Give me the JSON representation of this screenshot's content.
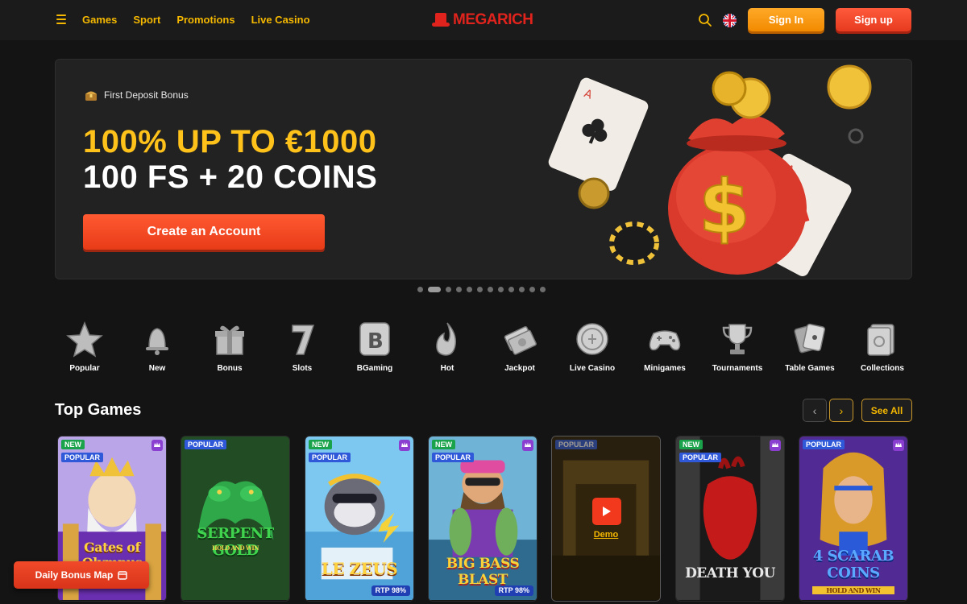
{
  "header": {
    "nav": [
      "Games",
      "Sport",
      "Promotions",
      "Live Casino"
    ],
    "logo_text": "MEGARICH",
    "signin_label": "Sign In",
    "signup_label": "Sign up",
    "icons": {
      "menu": "hamburger-icon",
      "search": "search-icon",
      "language": "uk-flag-icon"
    }
  },
  "hero": {
    "tag": "First Deposit Bonus",
    "line1": "100% UP TO €1000",
    "line2": "100 FS + 20 COINS",
    "cta": "Create an Account",
    "slide_count": 12,
    "active_slide": 2
  },
  "categories": [
    {
      "label": "Popular",
      "icon": "star-icon"
    },
    {
      "label": "New",
      "icon": "bell-icon"
    },
    {
      "label": "Bonus",
      "icon": "gift-icon"
    },
    {
      "label": "Slots",
      "icon": "seven-icon"
    },
    {
      "label": "BGaming",
      "icon": "bgaming-icon"
    },
    {
      "label": "Hot",
      "icon": "flame-icon"
    },
    {
      "label": "Jackpot",
      "icon": "money-stack-icon"
    },
    {
      "label": "Live Casino",
      "icon": "coin-icon"
    },
    {
      "label": "Minigames",
      "icon": "gamepad-icon"
    },
    {
      "label": "Tournaments",
      "icon": "trophy-icon"
    },
    {
      "label": "Table Games",
      "icon": "cards-icon"
    },
    {
      "label": "Collections",
      "icon": "collection-icon"
    }
  ],
  "top_games": {
    "title": "Top Games",
    "see_all": "See All",
    "games": [
      {
        "title": "Gates of Olympus",
        "badges": [
          "NEW",
          "POPULAR"
        ],
        "premium": true,
        "rtp": ""
      },
      {
        "title": "SERPENT GOLD",
        "subtitle": "HOLD AND WIN",
        "badges": [
          "POPULAR"
        ],
        "premium": false,
        "rtp": ""
      },
      {
        "title": "LE ZEUS",
        "badges": [
          "NEW",
          "POPULAR"
        ],
        "premium": true,
        "rtp": "RTP 98%"
      },
      {
        "title": "BIG BASS BLAST",
        "badges": [
          "NEW",
          "POPULAR"
        ],
        "premium": true,
        "rtp": "RTP 98%"
      },
      {
        "title": "",
        "badges": [
          "POPULAR"
        ],
        "premium": false,
        "rtp": "",
        "demo": "Demo"
      },
      {
        "title": "DEATH YOU",
        "badges": [
          "NEW",
          "POPULAR"
        ],
        "premium": true,
        "rtp": ""
      },
      {
        "title": "4 SCARAB COINS",
        "subtitle": "HOLD AND WIN",
        "badges": [
          "POPULAR"
        ],
        "premium": true,
        "rtp": ""
      }
    ]
  },
  "floating": {
    "bonus_map": "Daily Bonus Map"
  },
  "colors": {
    "accent": "#f5b800",
    "brand_red": "#e0231c",
    "cta_red": "#ff5a32",
    "bg": "#141414"
  }
}
